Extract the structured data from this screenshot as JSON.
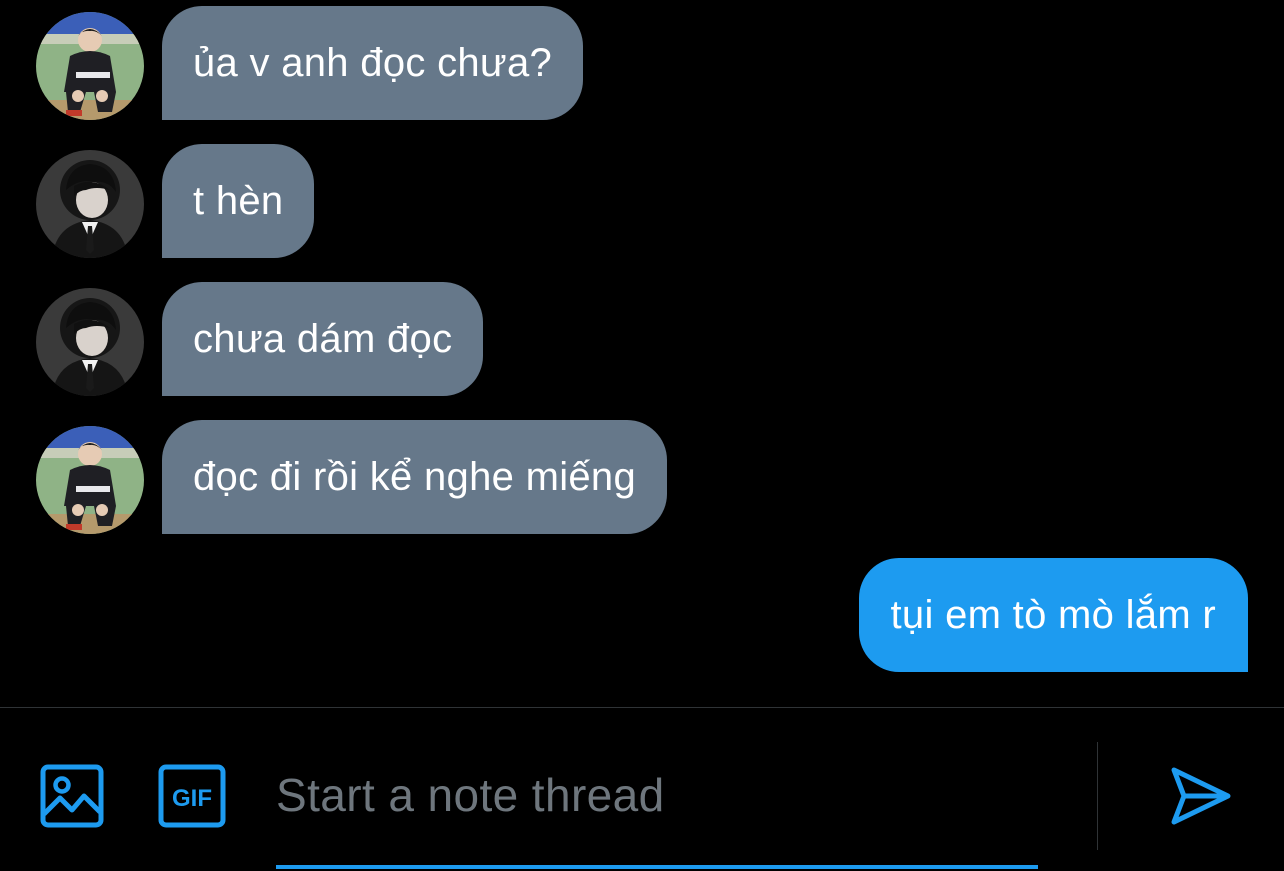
{
  "messages": [
    {
      "text": "ủa v anh đọc chưa?",
      "sender": "other",
      "avatar": "avatar-user-a"
    },
    {
      "text": "t hèn",
      "sender": "other",
      "avatar": "avatar-user-b"
    },
    {
      "text": "chưa dám đọc",
      "sender": "other",
      "avatar": "avatar-user-b"
    },
    {
      "text": "đọc đi rồi kể nghe miếng",
      "sender": "other",
      "avatar": "avatar-user-a"
    },
    {
      "text": "tụi em tò mò lắm r",
      "sender": "me"
    }
  ],
  "compose": {
    "placeholder": "Start a note thread",
    "image_icon": "image-icon",
    "gif_icon": "gif-icon",
    "gif_label": "GIF",
    "send_icon": "send-icon"
  },
  "colors": {
    "background": "#000000",
    "received_bubble": "#66788a",
    "sent_bubble": "#1d9bf0",
    "accent": "#1d9bf0",
    "placeholder": "#6e767d",
    "divider": "#2f3336"
  }
}
